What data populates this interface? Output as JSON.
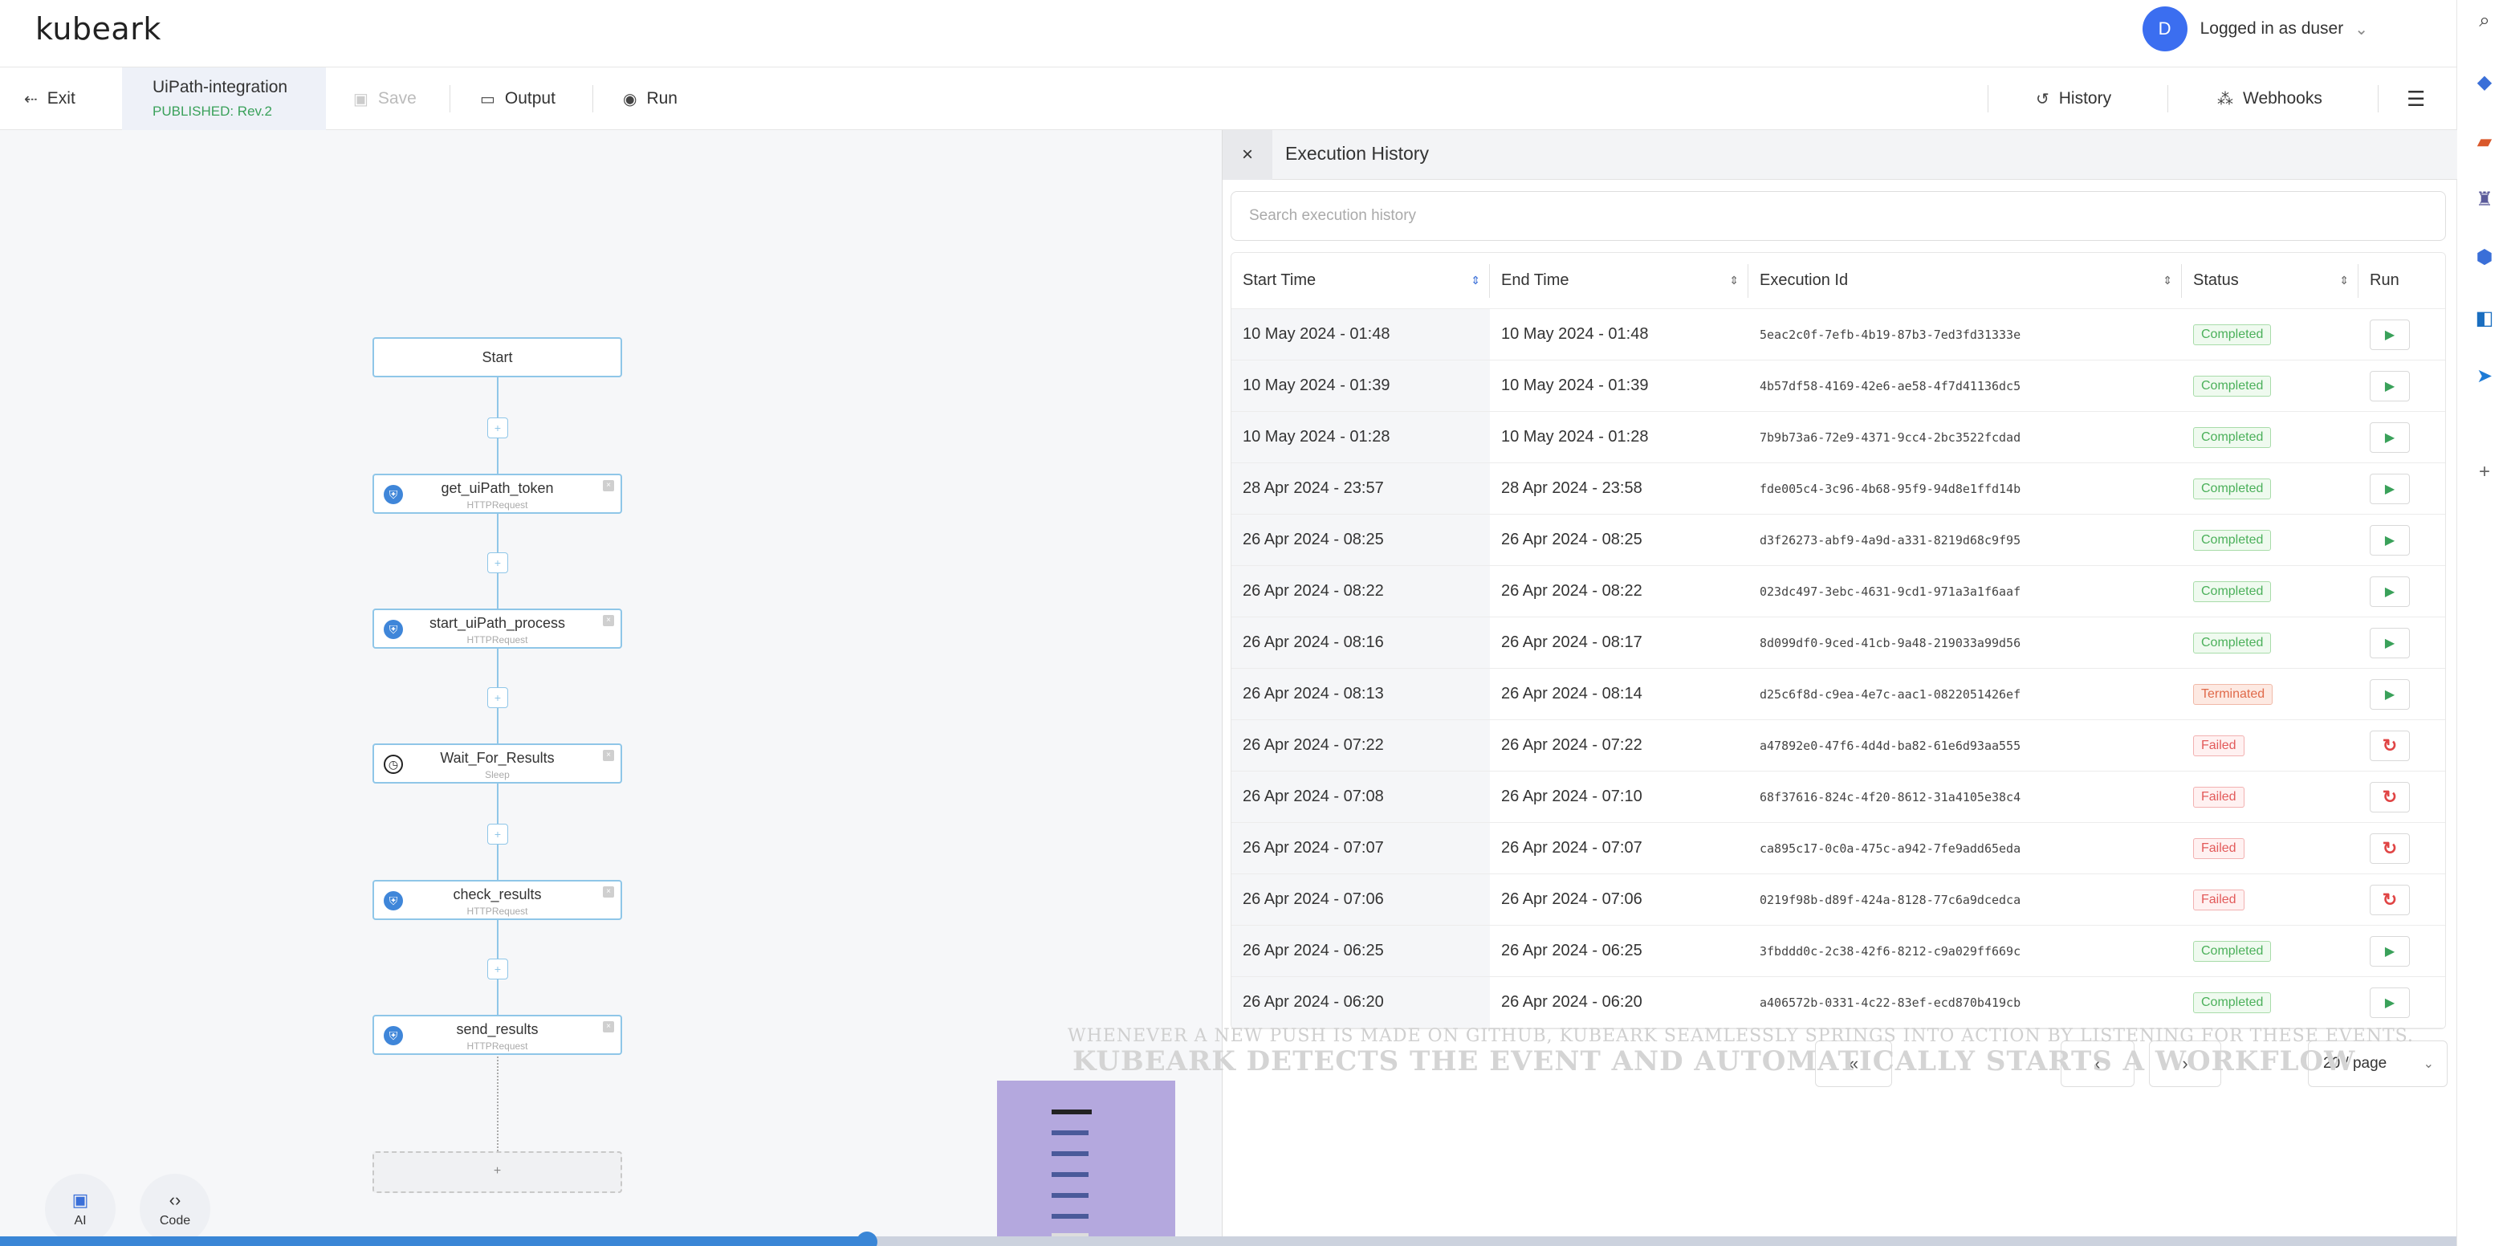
{
  "app": {
    "logo": "kubeark",
    "user_initial": "D",
    "user_label": "Logged in as duser"
  },
  "toolbar": {
    "exit_label": "Exit",
    "workflow_name": "UiPath-integration",
    "workflow_status": "PUBLISHED:  Rev.2",
    "save_label": "Save",
    "output_label": "Output",
    "run_label": "Run",
    "history_label": "History",
    "webhooks_label": "Webhooks"
  },
  "canvas": {
    "start_label": "Start",
    "nodes": [
      {
        "title": "get_uiPath_token",
        "type": "HTTPRequest",
        "icon": "http-icon"
      },
      {
        "title": "start_uiPath_process",
        "type": "HTTPRequest",
        "icon": "http-icon"
      },
      {
        "title": "Wait_For_Results",
        "type": "Sleep",
        "icon": "clock-icon"
      },
      {
        "title": "check_results",
        "type": "HTTPRequest",
        "icon": "http-icon"
      },
      {
        "title": "send_results",
        "type": "HTTPRequest",
        "icon": "http-icon"
      }
    ],
    "add_label": "+",
    "ai_label": "AI",
    "code_label": "Code"
  },
  "panel": {
    "title": "Execution History",
    "search_placeholder": "Search execution history",
    "columns": {
      "start": "Start Time",
      "end": "End Time",
      "id": "Execution Id",
      "status": "Status",
      "run": "Run"
    },
    "rows": [
      {
        "start": "10 May 2024 - 01:48",
        "end": "10 May 2024 - 01:48",
        "id": "5eac2c0f-7efb-4b19-87b3-7ed3fd31333e",
        "status": "Completed"
      },
      {
        "start": "10 May 2024 - 01:39",
        "end": "10 May 2024 - 01:39",
        "id": "4b57df58-4169-42e6-ae58-4f7d41136dc5",
        "status": "Completed"
      },
      {
        "start": "10 May 2024 - 01:28",
        "end": "10 May 2024 - 01:28",
        "id": "7b9b73a6-72e9-4371-9cc4-2bc3522fcdad",
        "status": "Completed"
      },
      {
        "start": "28 Apr 2024 - 23:57",
        "end": "28 Apr 2024 - 23:58",
        "id": "fde005c4-3c96-4b68-95f9-94d8e1ffd14b",
        "status": "Completed"
      },
      {
        "start": "26 Apr 2024 - 08:25",
        "end": "26 Apr 2024 - 08:25",
        "id": "d3f26273-abf9-4a9d-a331-8219d68c9f95",
        "status": "Completed"
      },
      {
        "start": "26 Apr 2024 - 08:22",
        "end": "26 Apr 2024 - 08:22",
        "id": "023dc497-3ebc-4631-9cd1-971a3a1f6aaf",
        "status": "Completed"
      },
      {
        "start": "26 Apr 2024 - 08:16",
        "end": "26 Apr 2024 - 08:17",
        "id": "8d099df0-9ced-41cb-9a48-219033a99d56",
        "status": "Completed"
      },
      {
        "start": "26 Apr 2024 - 08:13",
        "end": "26 Apr 2024 - 08:14",
        "id": "d25c6f8d-c9ea-4e7c-aac1-0822051426ef",
        "status": "Terminated"
      },
      {
        "start": "26 Apr 2024 - 07:22",
        "end": "26 Apr 2024 - 07:22",
        "id": "a47892e0-47f6-4d4d-ba82-61e6d93aa555",
        "status": "Failed"
      },
      {
        "start": "26 Apr 2024 - 07:08",
        "end": "26 Apr 2024 - 07:10",
        "id": "68f37616-824c-4f20-8612-31a4105e38c4",
        "status": "Failed"
      },
      {
        "start": "26 Apr 2024 - 07:07",
        "end": "26 Apr 2024 - 07:07",
        "id": "ca895c17-0c0a-475c-a942-7fe9add65eda",
        "status": "Failed"
      },
      {
        "start": "26 Apr 2024 - 07:06",
        "end": "26 Apr 2024 - 07:06",
        "id": "0219f98b-d89f-424a-8128-77c6a9dcedca",
        "status": "Failed"
      },
      {
        "start": "26 Apr 2024 - 06:25",
        "end": "26 Apr 2024 - 06:25",
        "id": "3fbddd0c-2c38-42f6-8212-c9a029ff669c",
        "status": "Completed"
      },
      {
        "start": "26 Apr 2024 - 06:20",
        "end": "26 Apr 2024 - 06:20",
        "id": "a406572b-0331-4c22-83ef-ecd870b419cb",
        "status": "Completed"
      }
    ],
    "pagination": {
      "first": "«",
      "prev": "‹",
      "next": "›",
      "page_size": "20 / page"
    }
  },
  "captions": {
    "line1": "WHENEVER A NEW PUSH IS MADE ON GITHUB, KUBEARK SEAMLESSLY SPRINGS INTO ACTION BY LISTENING FOR THESE EVENTS.",
    "line2": "KUBEARK DETECTS THE EVENT AND AUTOMATICALLY STARTS A WORKFLOW"
  },
  "video": {
    "progress": 0.353
  },
  "colors": {
    "accent": "#3b6ef0",
    "completed": "#4bb05a",
    "failed": "#e25a5a",
    "node_border": "#8fc6e8"
  }
}
